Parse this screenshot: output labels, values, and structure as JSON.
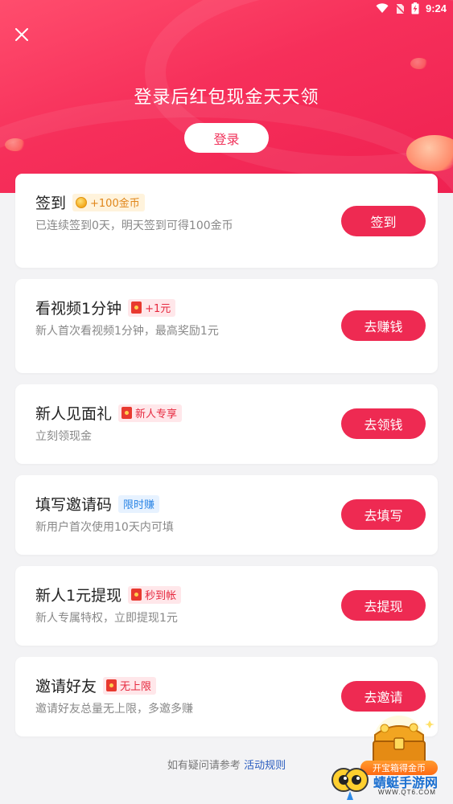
{
  "status_bar": {
    "time": "9:24"
  },
  "header": {
    "title": "登录后红包现金天天领",
    "login_label": "登录"
  },
  "tasks": [
    {
      "title": "签到",
      "badge": "+100金币",
      "desc": "已连续签到0天，明天签到可得100金币",
      "action": "签到"
    },
    {
      "title": "看视频1分钟",
      "badge": "+1元",
      "desc": "新人首次看视频1分钟，最高奖励1元",
      "action": "去赚钱"
    },
    {
      "title": "新人见面礼",
      "badge": "新人专享",
      "desc": "立刻领现金",
      "action": "去领钱"
    },
    {
      "title": "填写邀请码",
      "badge": "限时赚",
      "desc": "新用户首次使用10天内可填",
      "action": "去填写"
    },
    {
      "title": "新人1元提现",
      "badge": "秒到帐",
      "desc": "新人专属特权，立即提现1元",
      "action": "去提现"
    },
    {
      "title": "邀请好友",
      "badge": "无上限",
      "desc": "邀请好友总量无上限，多邀多赚",
      "action": "去邀请"
    }
  ],
  "footer": {
    "text": "如有疑问请参考",
    "link": "活动规则"
  },
  "chest": {
    "label": "开宝箱得金币"
  },
  "watermark": {
    "name": "蜻蜓手游网",
    "url": "WWW.QT6.COM"
  },
  "colors": {
    "primary": "#ee2a52",
    "header": "#f62f5a",
    "background": "#f3f3f5"
  }
}
